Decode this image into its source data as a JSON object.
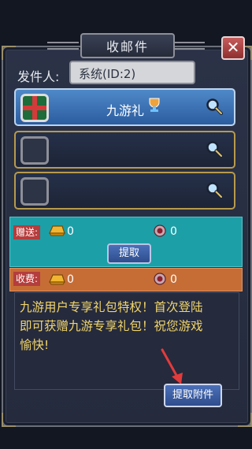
{
  "window": {
    "title": "收邮件",
    "close_symbol": "✕"
  },
  "sender": {
    "label": "发件人:",
    "value": "系统(ID:2)"
  },
  "attachments": [
    {
      "name": "九游礼",
      "icon": "gift-box-icon"
    },
    {
      "name": "",
      "icon": "empty-slot"
    },
    {
      "name": "",
      "icon": "empty-slot"
    }
  ],
  "gift_section": {
    "label": "赠送:",
    "gold_value": "0",
    "coin_value": "0",
    "button": "提取"
  },
  "fee_section": {
    "label": "收费:",
    "gold_value": "0",
    "coin_value": "0"
  },
  "message": {
    "line1": "九游用户专享礼包特权！首次登陆",
    "line2": "即可获赠九游专享礼包！祝您游戏",
    "line3": "愉快!"
  },
  "collect_attachments_button": "提取附件",
  "colors": {
    "cyan_panel": "#1d9fa7",
    "orange_panel": "#c66d36",
    "message_text": "#f1d56a"
  }
}
